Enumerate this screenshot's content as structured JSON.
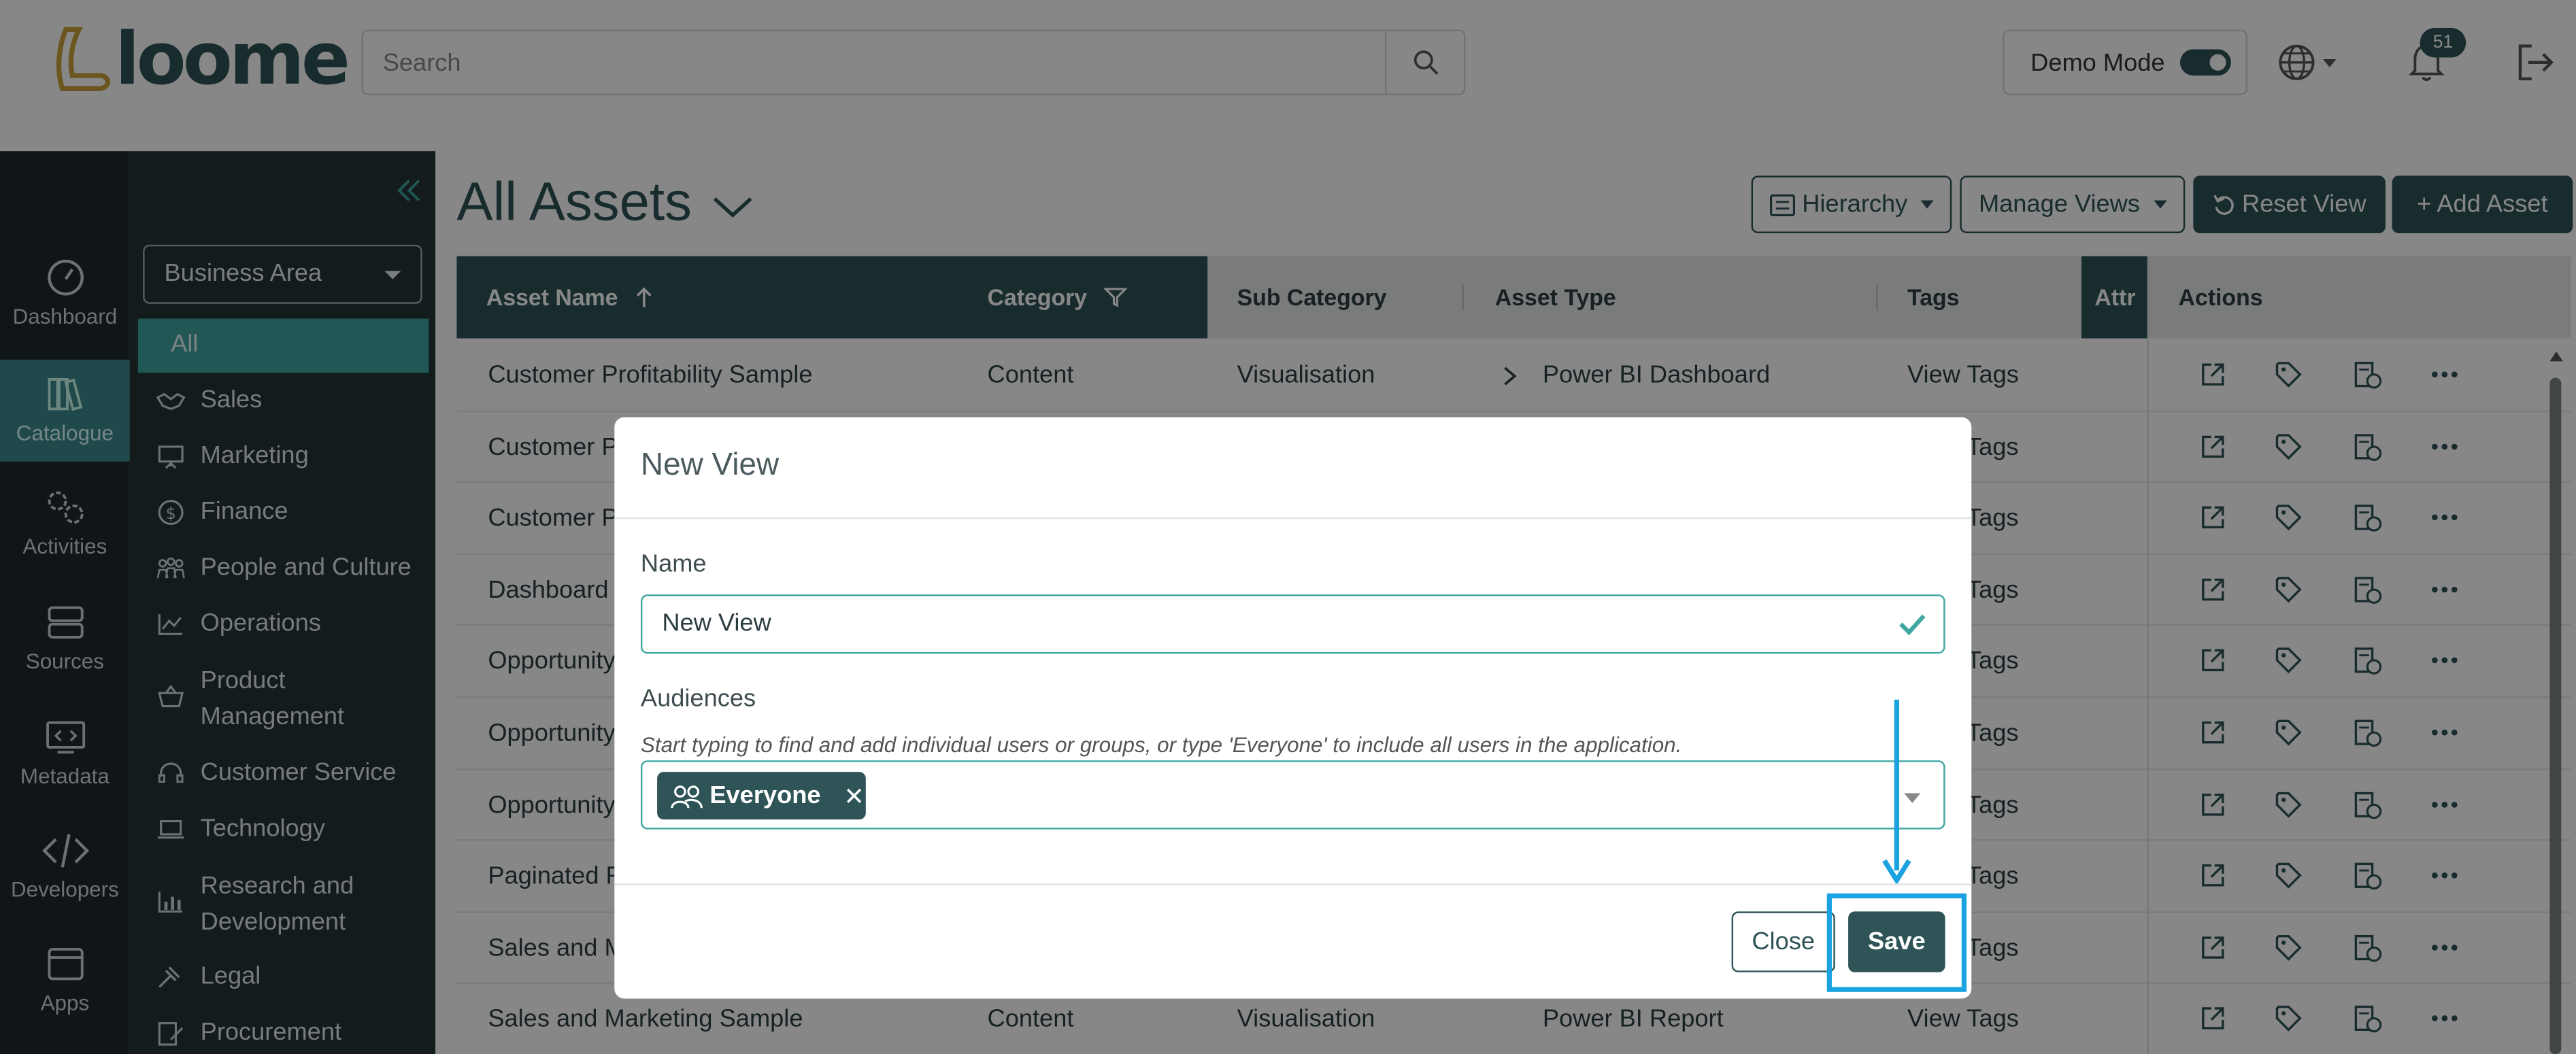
{
  "header": {
    "logo_text": "loome",
    "search_placeholder": "Search",
    "demo_mode_label": "Demo Mode",
    "notification_count": "51"
  },
  "leftnav": {
    "items": [
      {
        "label": "Dashboard",
        "icon": "gauge-icon"
      },
      {
        "label": "Catalogue",
        "icon": "books-icon"
      },
      {
        "label": "Activities",
        "icon": "gears-icon"
      },
      {
        "label": "Sources",
        "icon": "server-icon"
      },
      {
        "label": "Metadata",
        "icon": "monitor-code-icon"
      },
      {
        "label": "Developers",
        "icon": "code-icon"
      },
      {
        "label": "Apps",
        "icon": "window-icon"
      }
    ]
  },
  "sidebar": {
    "select_value": "Business Area",
    "items": [
      {
        "label": "All"
      },
      {
        "label": "Sales"
      },
      {
        "label": "Marketing"
      },
      {
        "label": "Finance"
      },
      {
        "label": "People and Culture"
      },
      {
        "label": "Operations"
      },
      {
        "label": "Product Management"
      },
      {
        "label": "Customer Service"
      },
      {
        "label": "Technology"
      },
      {
        "label": "Research and Development"
      },
      {
        "label": "Legal"
      },
      {
        "label": "Procurement"
      }
    ]
  },
  "main": {
    "title": "All Assets",
    "toolbar": {
      "hierarchy": "Hierarchy",
      "manage_views": "Manage Views",
      "reset_view": "Reset View",
      "add_asset": "+ Add Asset"
    },
    "columns": {
      "asset_name": "Asset Name",
      "category": "Category",
      "sub_category": "Sub Category",
      "asset_type": "Asset Type",
      "tags": "Tags",
      "attr": "Attr",
      "actions": "Actions"
    },
    "rows": [
      {
        "name": "Customer Profitability Sample",
        "category": "Content",
        "sub_category": "Visualisation",
        "asset_type": "Power BI Dashboard",
        "tags": "View Tags"
      },
      {
        "name": "Customer P",
        "category": "",
        "sub_category": "",
        "asset_type": "",
        "tags": "Tags"
      },
      {
        "name": "Customer P",
        "category": "",
        "sub_category": "",
        "asset_type": "",
        "tags": "Tags"
      },
      {
        "name": "Dashboard U",
        "category": "",
        "sub_category": "",
        "asset_type": "",
        "tags": "Tags"
      },
      {
        "name": "Opportunity",
        "category": "",
        "sub_category": "",
        "asset_type": "",
        "tags": "Tags"
      },
      {
        "name": "Opportunity",
        "category": "",
        "sub_category": "",
        "asset_type": "",
        "tags": "Tags"
      },
      {
        "name": "Opportunity",
        "category": "",
        "sub_category": "",
        "asset_type": "",
        "tags": "Tags"
      },
      {
        "name": "Paginated R",
        "category": "",
        "sub_category": "",
        "asset_type": "",
        "tags": "Tags"
      },
      {
        "name": "Sales and M",
        "category": "",
        "sub_category": "",
        "asset_type": "",
        "tags": "Tags"
      },
      {
        "name": "Sales and Marketing Sample",
        "category": "Content",
        "sub_category": "Visualisation",
        "asset_type": "Power BI Report",
        "tags": "View Tags"
      }
    ]
  },
  "modal": {
    "title": "New View",
    "name_label": "Name",
    "name_value": "New View",
    "audiences_label": "Audiences",
    "audiences_help": "Start typing to find and add individual users or groups, or type 'Everyone' to include all users in the application.",
    "audience_chip": "Everyone",
    "close_label": "Close",
    "save_label": "Save"
  },
  "colors": {
    "brand_dark": "#2e5458",
    "accent_teal": "#3fa6a0",
    "nav_bg": "#1f2b2d",
    "annotation_blue": "#1aa3e0"
  }
}
